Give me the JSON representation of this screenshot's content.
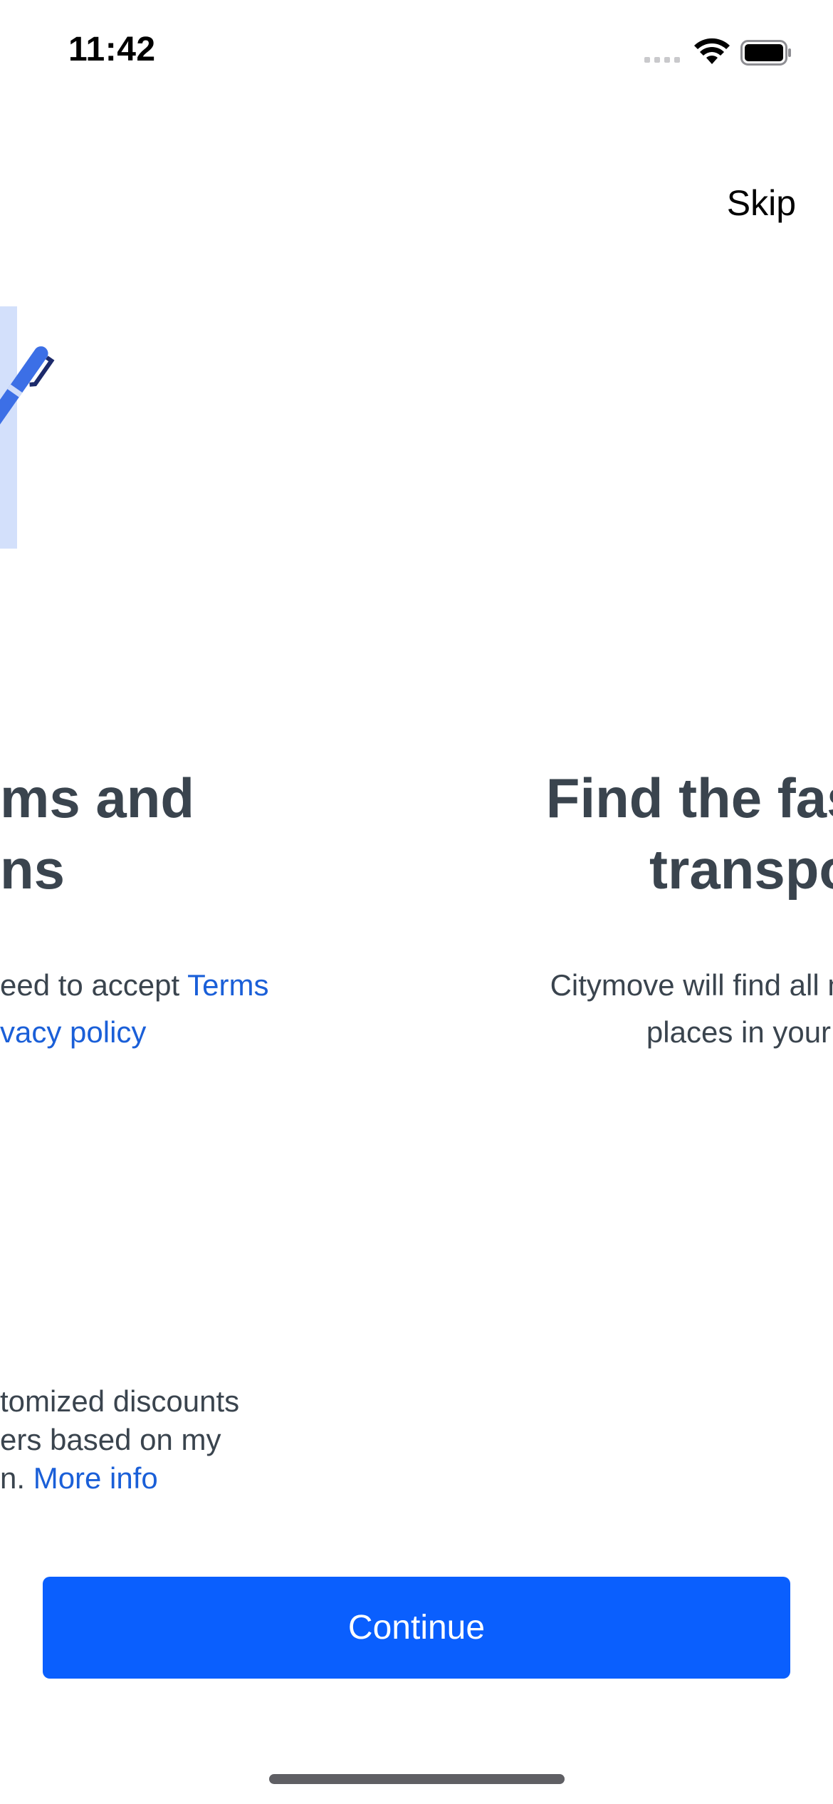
{
  "status_bar": {
    "time": "11:42"
  },
  "header": {
    "skip_label": "Skip"
  },
  "pages": {
    "terms": {
      "heading_line1": "ms and",
      "heading_line2": "ns",
      "body_line1_text": "eed to accept ",
      "body_line1_link": "Terms",
      "body_line2_link": "vacy policy",
      "consent_line1": "tomized discounts",
      "consent_line2": "ers based on my",
      "consent_line3_text": "n. ",
      "consent_line3_link": "More info"
    },
    "transport": {
      "heading_line1": "Find the fastest",
      "heading_line2": "transpo",
      "body_line1": "Citymove will find all mobility s",
      "body_line2": "places in your a"
    }
  },
  "footer": {
    "continue_label": "Continue"
  },
  "colors": {
    "accent": "#0a5ffe",
    "link": "#1a5fd8",
    "text": "#3a444e",
    "illustration_light": "#e3ecfd",
    "pen_blue": "#3c6fe6"
  },
  "icons": [
    "wifi-icon",
    "battery-icon",
    "cellular-signal-icon",
    "pen-illustration"
  ]
}
